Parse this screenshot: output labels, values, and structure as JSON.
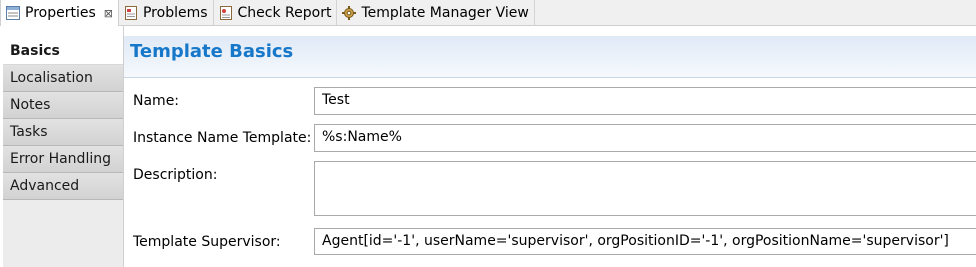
{
  "tabs": [
    {
      "label": "Properties",
      "icon": "properties-icon",
      "active": true,
      "close": "⊠"
    },
    {
      "label": "Problems",
      "icon": "problems-icon",
      "active": false
    },
    {
      "label": "Check Report",
      "icon": "check-report-icon",
      "active": false
    },
    {
      "label": "Template Manager View",
      "icon": "gear-icon",
      "active": false
    }
  ],
  "nav": {
    "items": [
      {
        "label": "Basics",
        "selected": true
      },
      {
        "label": "Localisation",
        "selected": false
      },
      {
        "label": "Notes",
        "selected": false
      },
      {
        "label": "Tasks",
        "selected": false
      },
      {
        "label": "Error Handling",
        "selected": false
      },
      {
        "label": "Advanced",
        "selected": false
      }
    ]
  },
  "section": {
    "title": "Template Basics"
  },
  "form": {
    "name_label": "Name:",
    "name_value": "Test",
    "instance_label": "Instance Name Template:",
    "instance_value": "%s:Name%",
    "description_label": "Description:",
    "description_value": "",
    "supervisor_label": "Template Supervisor:",
    "supervisor_value": "Agent[id='-1', userName='supervisor', orgPositionID='-1', orgPositionName='supervisor']"
  },
  "colors": {
    "title": "#1778c9",
    "header_bg": "#dfe9f6"
  }
}
